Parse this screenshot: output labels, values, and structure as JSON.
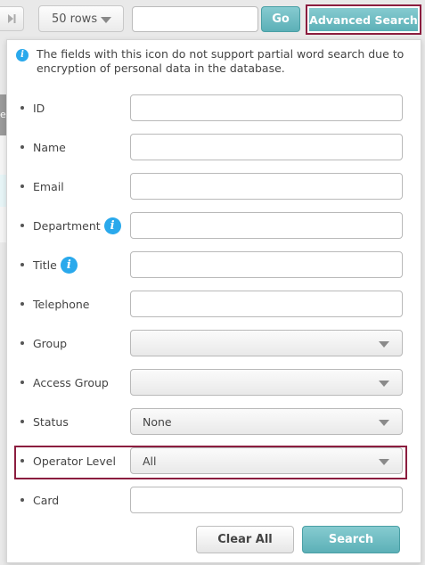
{
  "toolbar": {
    "rows_label": "50 rows",
    "search_value": "",
    "go_label": "Go",
    "advanced_search_label": "Advanced Search"
  },
  "background": {
    "fragment_text": "e"
  },
  "panel": {
    "notice_icon": "i",
    "notice_text": "The fields with this icon do not support partial word search due to encryption of personal data in the database.",
    "fields": [
      {
        "label": "ID",
        "type": "text",
        "value": "",
        "info": false
      },
      {
        "label": "Name",
        "type": "text",
        "value": "",
        "info": false
      },
      {
        "label": "Email",
        "type": "text",
        "value": "",
        "info": false
      },
      {
        "label": "Department",
        "type": "text",
        "value": "",
        "info": true
      },
      {
        "label": "Title",
        "type": "text",
        "value": "",
        "info": true
      },
      {
        "label": "Telephone",
        "type": "text",
        "value": "",
        "info": false
      },
      {
        "label": "Group",
        "type": "select",
        "value": "",
        "info": false
      },
      {
        "label": "Access Group",
        "type": "select",
        "value": "",
        "info": false
      },
      {
        "label": "Status",
        "type": "select",
        "value": "None",
        "info": false
      },
      {
        "label": "Operator Level",
        "type": "select",
        "value": "All",
        "info": false
      },
      {
        "label": "Card",
        "type": "text",
        "value": "",
        "info": false
      }
    ],
    "clear_all_label": "Clear All",
    "search_label": "Search"
  },
  "colors": {
    "accent_teal": "#5cb0b7",
    "highlight_border": "#8b1d3f",
    "info_icon_blue": "#2aa9ec"
  }
}
